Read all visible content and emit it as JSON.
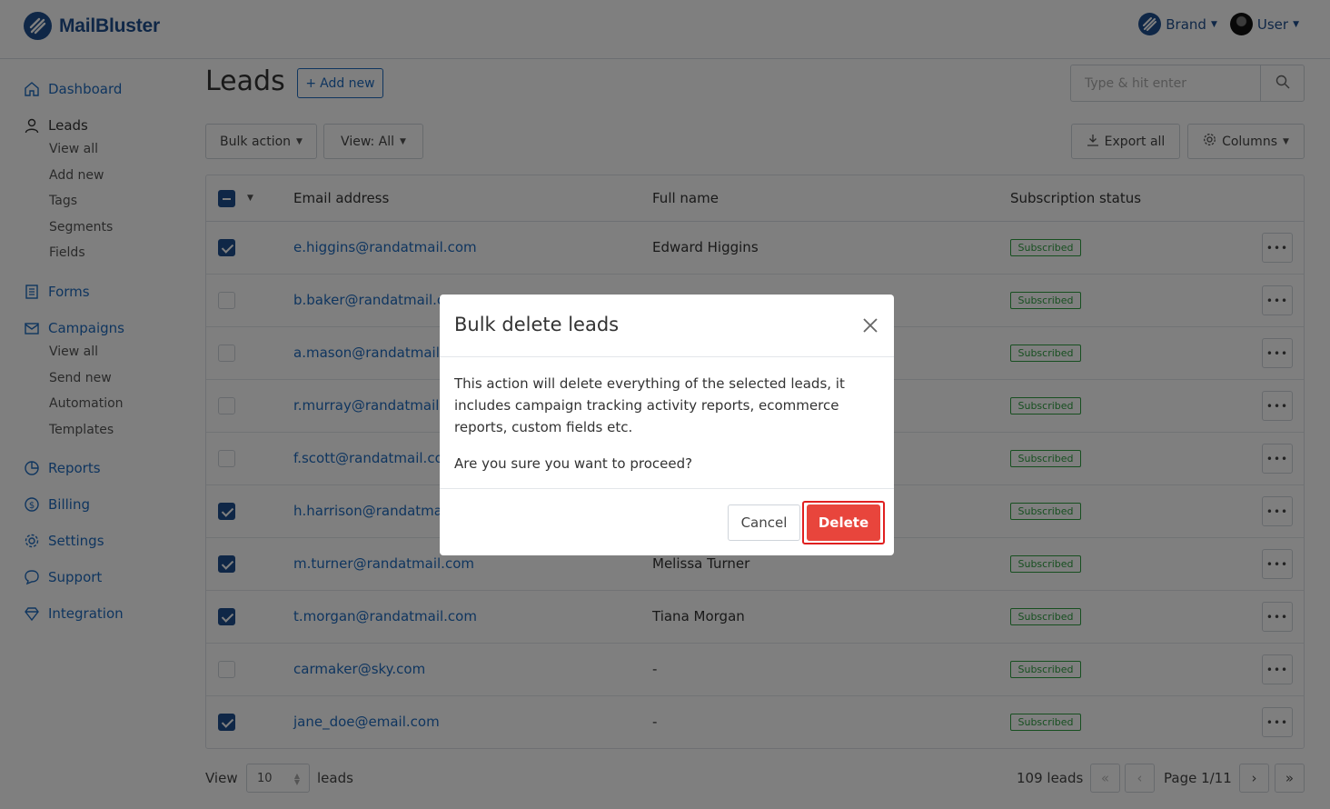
{
  "app": {
    "name": "MailBluster"
  },
  "topbar": {
    "brand_label": "Brand",
    "user_label": "User"
  },
  "sidebar": {
    "dashboard": "Dashboard",
    "leads": {
      "label": "Leads",
      "items": [
        "View all",
        "Add new",
        "Tags",
        "Segments",
        "Fields"
      ]
    },
    "forms": "Forms",
    "campaigns": {
      "label": "Campaigns",
      "items": [
        "View all",
        "Send new",
        "Automation",
        "Templates"
      ]
    },
    "reports": "Reports",
    "billing": "Billing",
    "settings": "Settings",
    "support": "Support",
    "integration": "Integration"
  },
  "page": {
    "title": "Leads",
    "add_new": "Add new",
    "search_placeholder": "Type & hit enter",
    "bulk_action": "Bulk action",
    "view_all": "View: All",
    "export_all": "Export all",
    "columns": "Columns"
  },
  "table": {
    "headers": {
      "email": "Email address",
      "name": "Full name",
      "status": "Subscription status"
    },
    "rows": [
      {
        "checked": true,
        "email": "e.higgins@randatmail.com",
        "name": "Edward Higgins",
        "status": "Subscribed"
      },
      {
        "checked": false,
        "email": "b.baker@randatmail.com",
        "name": "",
        "status": "Subscribed"
      },
      {
        "checked": false,
        "email": "a.mason@randatmail.com",
        "name": "",
        "status": "Subscribed"
      },
      {
        "checked": false,
        "email": "r.murray@randatmail.com",
        "name": "",
        "status": "Subscribed"
      },
      {
        "checked": false,
        "email": "f.scott@randatmail.com",
        "name": "",
        "status": "Subscribed"
      },
      {
        "checked": true,
        "email": "h.harrison@randatmail.com",
        "name": "",
        "status": "Subscribed"
      },
      {
        "checked": true,
        "email": "m.turner@randatmail.com",
        "name": "Melissa Turner",
        "status": "Subscribed"
      },
      {
        "checked": true,
        "email": "t.morgan@randatmail.com",
        "name": "Tiana Morgan",
        "status": "Subscribed"
      },
      {
        "checked": false,
        "email": "carmaker@sky.com",
        "name": "-",
        "status": "Subscribed"
      },
      {
        "checked": true,
        "email": "jane_doe@email.com",
        "name": "-",
        "status": "Subscribed"
      }
    ]
  },
  "footer": {
    "view_label": "View",
    "per_page": "10",
    "leads_label": "leads",
    "total": "109 leads",
    "page_label": "Page 1/11"
  },
  "modal": {
    "title": "Bulk delete leads",
    "body_1": "This action will delete everything of the selected leads, it includes campaign tracking activity reports, ecommerce reports, custom fields etc.",
    "body_2": "Are you sure you want to proceed?",
    "cancel": "Cancel",
    "delete": "Delete"
  },
  "colors": {
    "brand": "#1f4f8e",
    "link": "#1f6bbf",
    "danger": "#e8453c",
    "success": "#2e9e40"
  }
}
